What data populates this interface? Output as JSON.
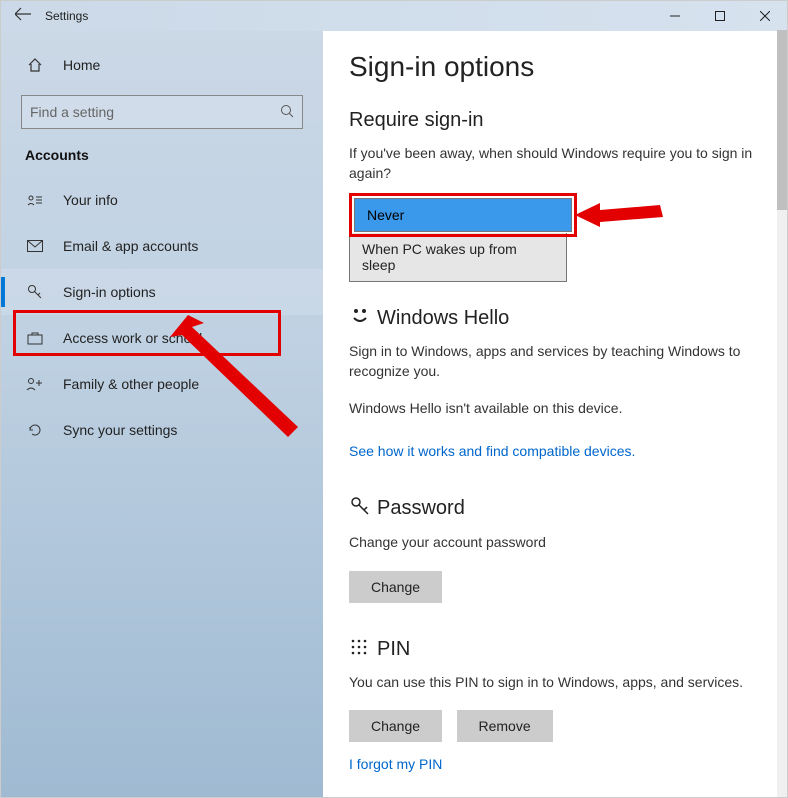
{
  "window": {
    "title": "Settings"
  },
  "sidebar": {
    "home": "Home",
    "search_placeholder": "Find a setting",
    "category": "Accounts",
    "items": [
      {
        "label": "Your info"
      },
      {
        "label": "Email & app accounts"
      },
      {
        "label": "Sign-in options"
      },
      {
        "label": "Access work or school"
      },
      {
        "label": "Family & other people"
      },
      {
        "label": "Sync your settings"
      }
    ]
  },
  "content": {
    "page_title": "Sign-in options",
    "require": {
      "heading": "Require sign-in",
      "desc": "If you've been away, when should Windows require you to sign in again?",
      "selected": "Never",
      "other_option": "When PC wakes up from sleep"
    },
    "hello": {
      "heading": "Windows Hello",
      "desc": "Sign in to Windows, apps and services by teaching Windows to recognize you.",
      "unavailable": "Windows Hello isn't available on this device.",
      "link": "See how it works and find compatible devices."
    },
    "password": {
      "heading": "Password",
      "desc": "Change your account password",
      "button": "Change"
    },
    "pin": {
      "heading": "PIN",
      "desc": "You can use this PIN to sign in to Windows, apps, and services.",
      "change": "Change",
      "remove": "Remove",
      "forgot": "I forgot my PIN"
    }
  }
}
